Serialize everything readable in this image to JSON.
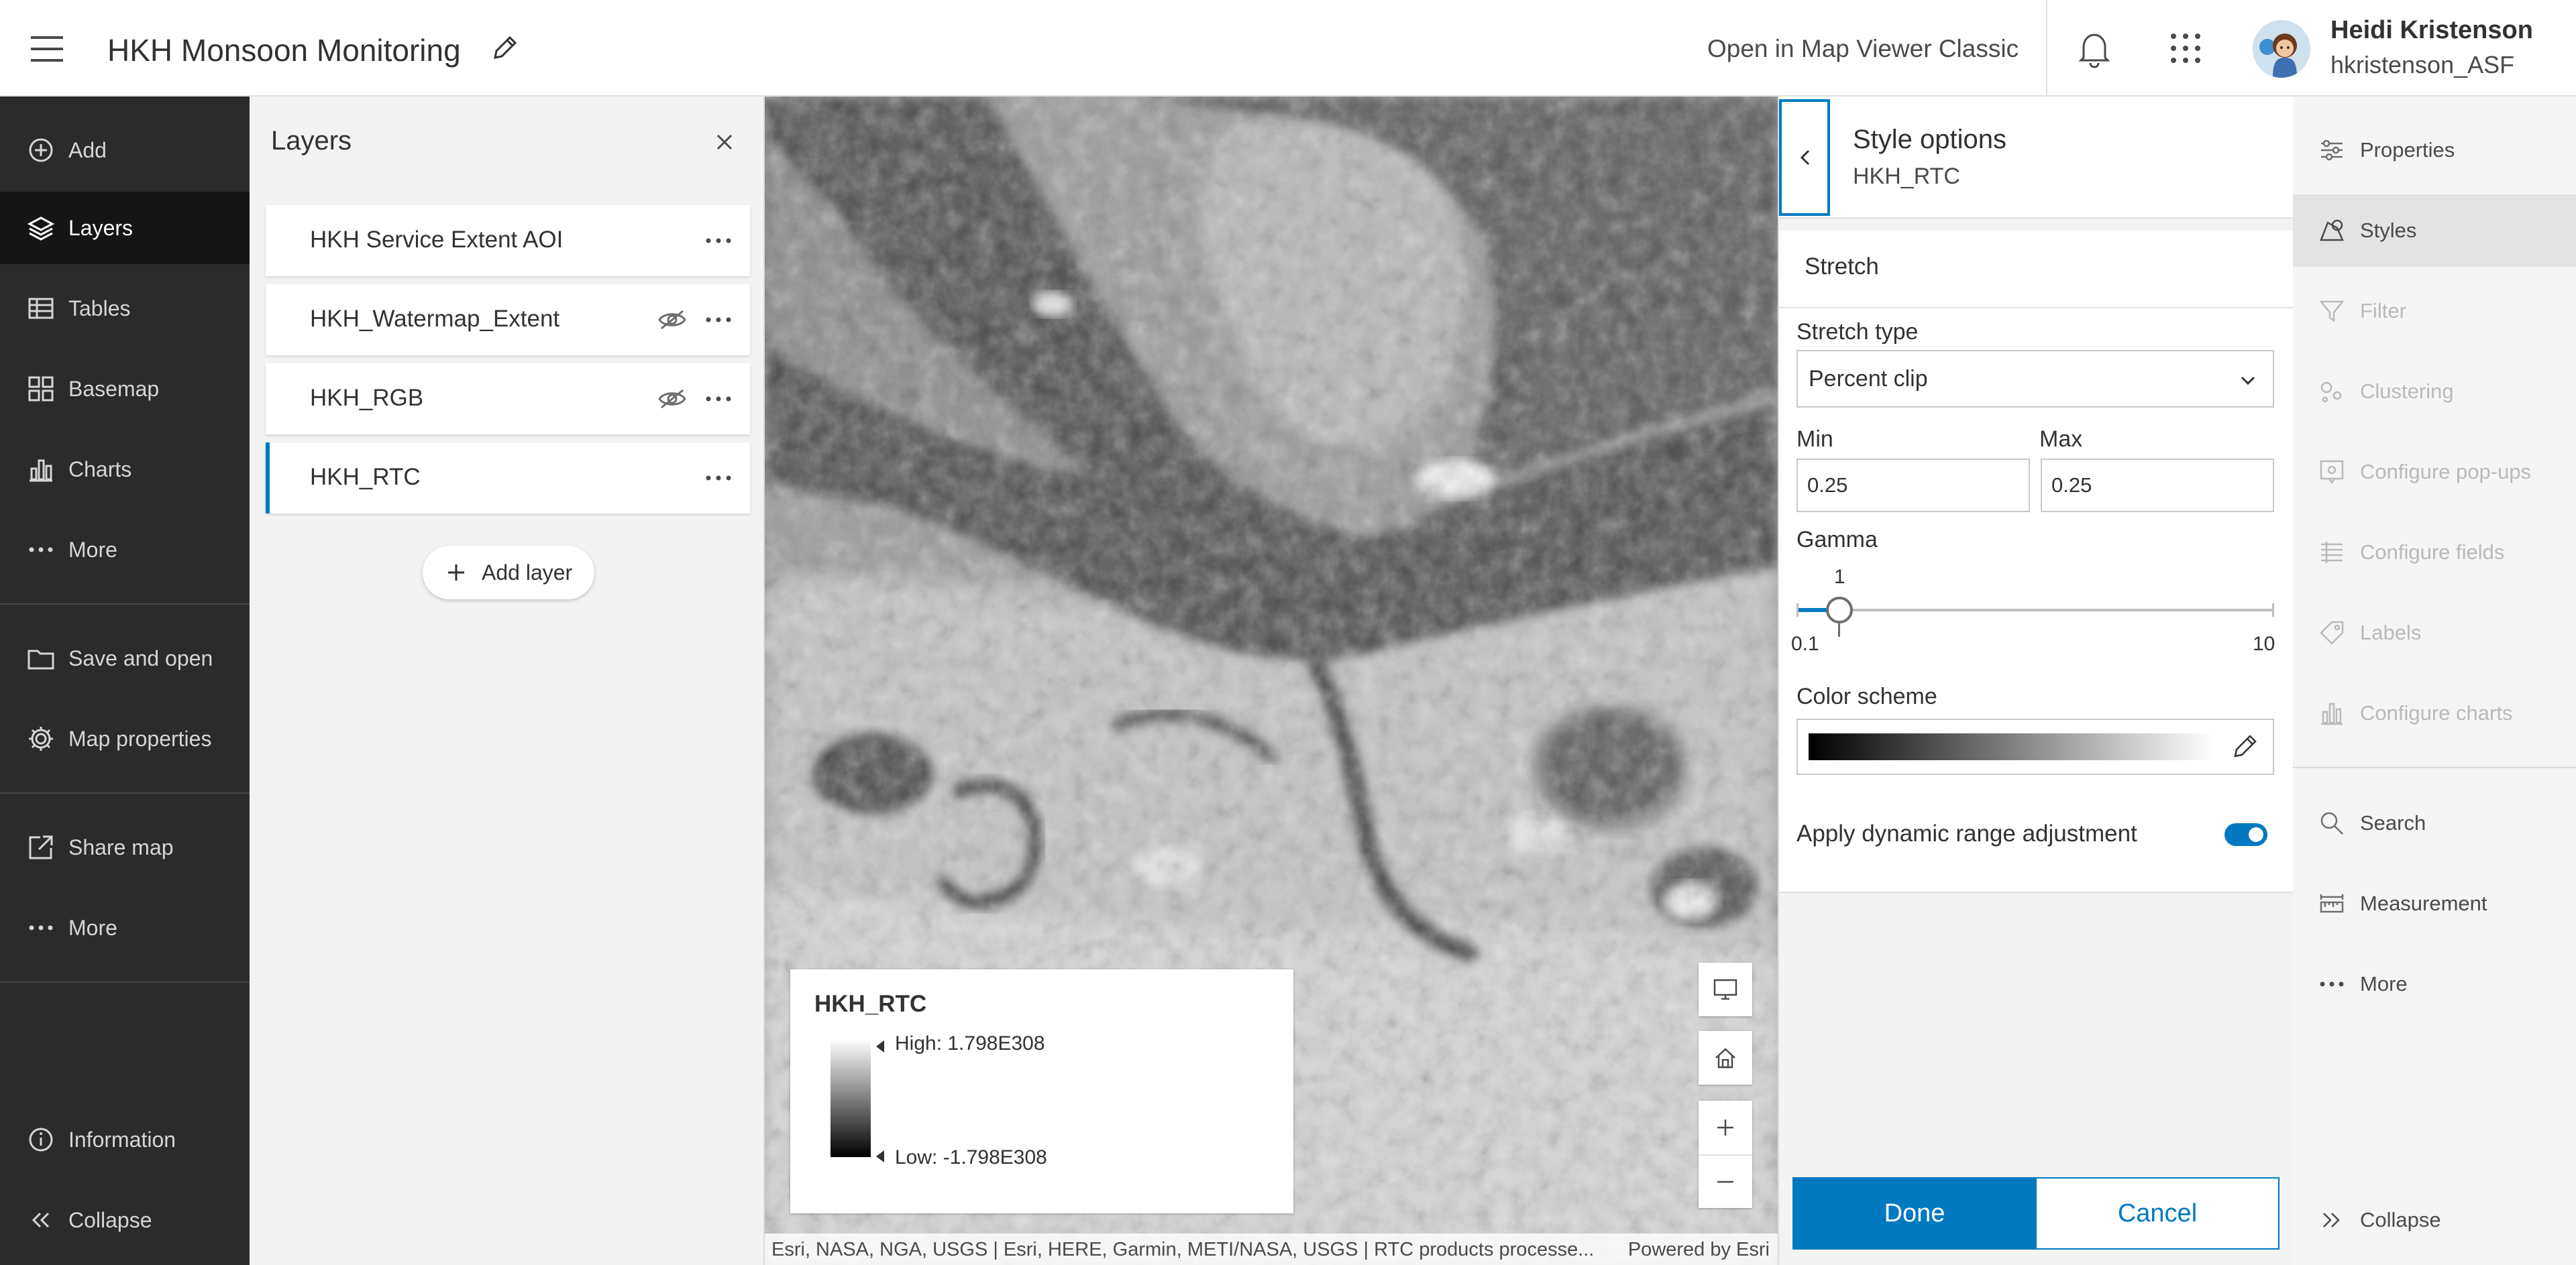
{
  "header": {
    "title": "HKH Monsoon Monitoring",
    "open_classic": "Open in Map Viewer Classic",
    "user_name": "Heidi Kristenson",
    "user_id": "hkristenson_ASF"
  },
  "left_toolbar": {
    "items": [
      {
        "label": "Add",
        "icon": "plus-circle-icon"
      },
      {
        "label": "Layers",
        "icon": "layers-icon"
      },
      {
        "label": "Tables",
        "icon": "table-icon"
      },
      {
        "label": "Basemap",
        "icon": "basemap-icon"
      },
      {
        "label": "Charts",
        "icon": "chart-icon"
      },
      {
        "label": "More",
        "icon": "ellipsis-icon"
      },
      {
        "label": "Save and open",
        "icon": "folder-icon"
      },
      {
        "label": "Map properties",
        "icon": "gear-icon"
      },
      {
        "label": "Share map",
        "icon": "share-icon"
      },
      {
        "label": "More",
        "icon": "ellipsis-icon"
      },
      {
        "label": "Information",
        "icon": "info-icon"
      },
      {
        "label": "Collapse",
        "icon": "double-chevron-left-icon"
      }
    ],
    "active": "Layers"
  },
  "layers_panel": {
    "title": "Layers",
    "layers": [
      {
        "name": "HKH Service Extent AOI",
        "hidden": false
      },
      {
        "name": "HKH_Watermap_Extent",
        "hidden": true
      },
      {
        "name": "HKH_RGB",
        "hidden": true
      },
      {
        "name": "HKH_RTC",
        "hidden": false,
        "selected": true
      }
    ],
    "add_layer": "Add layer"
  },
  "legend": {
    "title": "HKH_RTC",
    "high": "High: 1.798E308",
    "low": "Low: -1.798E308"
  },
  "attribution": {
    "text": "Esri, NASA, NGA, USGS | Esri, HERE, Garmin, METI/NASA, USGS | RTC products processe...",
    "powered_by": "Powered by Esri"
  },
  "style_options": {
    "title": "Style options",
    "layer": "HKH_RTC",
    "section": "Stretch",
    "stretch_type_label": "Stretch type",
    "stretch_type_value": "Percent clip",
    "min_label": "Min",
    "min_value": "0.25",
    "max_label": "Max",
    "max_value": "0.25",
    "gamma_label": "Gamma",
    "gamma_value": "1",
    "gamma_min": "0.1",
    "gamma_max": "10",
    "color_scheme_label": "Color scheme",
    "color_scheme_ramp": [
      "#000000",
      "#ffffff"
    ],
    "dynamic_range_label": "Apply dynamic range adjustment",
    "dynamic_range_on": true,
    "done": "Done",
    "cancel": "Cancel"
  },
  "right_toolbar": {
    "items": [
      {
        "label": "Properties",
        "icon": "properties-icon",
        "enabled": true
      },
      {
        "label": "Styles",
        "icon": "styles-icon",
        "enabled": true,
        "active": true
      },
      {
        "label": "Filter",
        "icon": "filter-icon",
        "enabled": false
      },
      {
        "label": "Clustering",
        "icon": "clustering-icon",
        "enabled": false
      },
      {
        "label": "Configure pop-ups",
        "icon": "popup-icon",
        "enabled": false
      },
      {
        "label": "Configure fields",
        "icon": "fields-icon",
        "enabled": false
      },
      {
        "label": "Labels",
        "icon": "label-icon",
        "enabled": false
      },
      {
        "label": "Configure charts",
        "icon": "chart-icon",
        "enabled": false
      },
      {
        "label": "Search",
        "icon": "search-icon",
        "enabled": true
      },
      {
        "label": "Measurement",
        "icon": "measure-icon",
        "enabled": true
      },
      {
        "label": "More",
        "icon": "ellipsis-icon",
        "enabled": true
      },
      {
        "label": "Collapse",
        "icon": "double-chevron-right-icon",
        "enabled": true
      }
    ]
  },
  "colors": {
    "accent": "#0079c1",
    "left_toolbar_bg": "#2b2b2b",
    "panel_bg": "#f3f3f3"
  }
}
